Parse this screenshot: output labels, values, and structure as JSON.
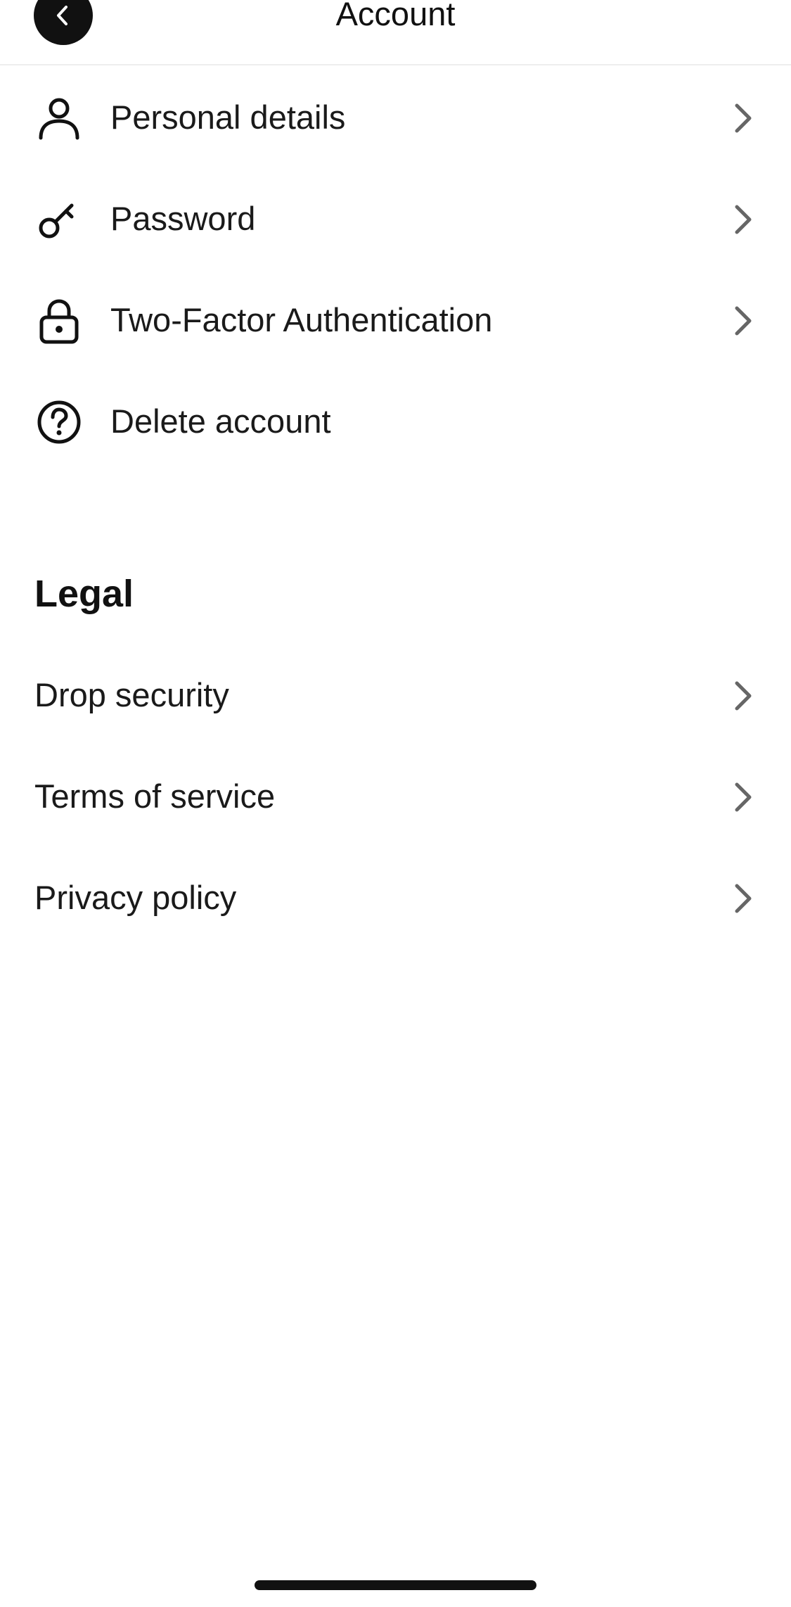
{
  "header": {
    "title": "Account",
    "back_icon": "chevron-left-icon"
  },
  "account_items": [
    {
      "label": "Personal details",
      "icon": "person-icon",
      "chevron": true
    },
    {
      "label": "Password",
      "icon": "key-icon",
      "chevron": true
    },
    {
      "label": "Two-Factor Authentication",
      "icon": "lock-icon",
      "chevron": true
    },
    {
      "label": "Delete account",
      "icon": "question-circle-icon",
      "chevron": false
    }
  ],
  "legal": {
    "title": "Legal",
    "items": [
      {
        "label": "Drop security"
      },
      {
        "label": "Terms of service"
      },
      {
        "label": "Privacy policy"
      }
    ]
  },
  "colors": {
    "text": "#111111",
    "chevron": "#666666",
    "back_button_bg": "#111111",
    "divider": "#eeeeee"
  }
}
